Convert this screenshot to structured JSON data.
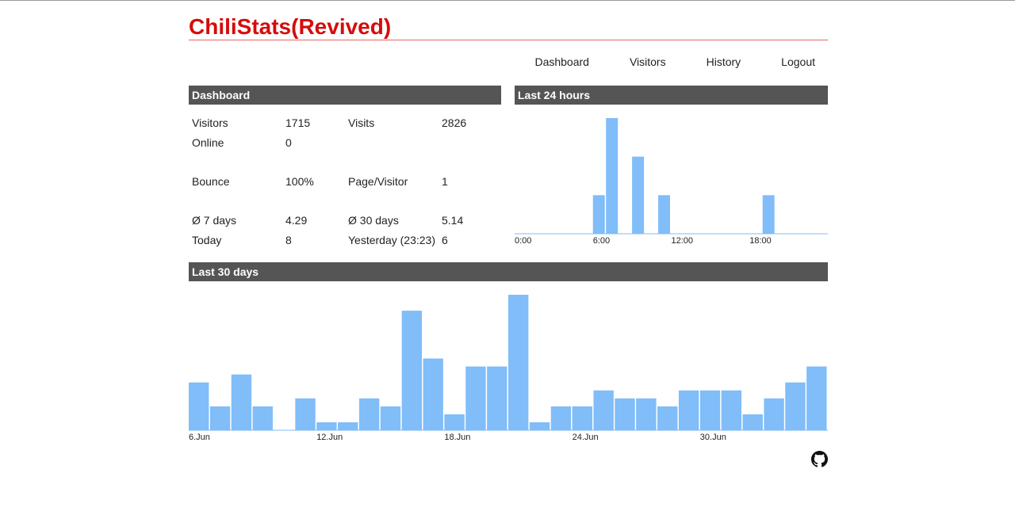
{
  "site": {
    "title": "ChiliStats(Revived)"
  },
  "nav": {
    "items": [
      "Dashboard",
      "Visitors",
      "History",
      "Logout"
    ]
  },
  "dashboard": {
    "header": "Dashboard",
    "stats": [
      {
        "label": "Visitors",
        "value": "1715"
      },
      {
        "label": "Visits",
        "value": "2826"
      },
      {
        "label": "Online",
        "value": "0"
      },
      {
        "label": "Bounce",
        "value": "100%"
      },
      {
        "label": "Page/Visitor",
        "value": "1"
      },
      {
        "label": "Ø 7 days",
        "value": "4.29"
      },
      {
        "label": "Ø 30 days",
        "value": "5.14"
      },
      {
        "label": "Today",
        "value": "8"
      },
      {
        "label": "Yesterday (23:23)",
        "value": "6"
      }
    ]
  },
  "last24": {
    "header": "Last 24 hours"
  },
  "last30": {
    "header": "Last 30 days"
  },
  "colors": {
    "bar": "#80bdf9",
    "header_bg": "#555555",
    "title": "#d60c0c"
  },
  "footer": {
    "icon": "github-icon"
  },
  "chart_data": [
    {
      "type": "bar",
      "categories": [
        "0",
        "1",
        "2",
        "3",
        "4",
        "5",
        "6",
        "7",
        "8",
        "9",
        "10",
        "11",
        "12",
        "13",
        "14",
        "15",
        "16",
        "17",
        "18",
        "19",
        "20",
        "21",
        "22",
        "23"
      ],
      "tick_labels": [
        {
          "index": 0,
          "label": "0:00"
        },
        {
          "index": 6,
          "label": "6:00"
        },
        {
          "index": 12,
          "label": "12:00"
        },
        {
          "index": 18,
          "label": "18:00"
        }
      ],
      "values": [
        0,
        0,
        0,
        0,
        0,
        0,
        1,
        3,
        0,
        2,
        0,
        1,
        0,
        0,
        0,
        0,
        0,
        0,
        0,
        1,
        0,
        0,
        0,
        0
      ],
      "ylim": [
        0,
        3
      ]
    },
    {
      "type": "bar",
      "categories": [
        "6.Jun",
        "7.Jun",
        "8.Jun",
        "9.Jun",
        "10.Jun",
        "11.Jun",
        "12.Jun",
        "13.Jun",
        "14.Jun",
        "15.Jun",
        "16.Jun",
        "17.Jun",
        "18.Jun",
        "19.Jun",
        "20.Jun",
        "21.Jun",
        "22.Jun",
        "23.Jun",
        "24.Jun",
        "25.Jun",
        "26.Jun",
        "27.Jun",
        "28.Jun",
        "29.Jun",
        "30.Jun",
        "1.Jul",
        "2.Jul",
        "3.Jul",
        "4.Jul",
        "5.Jul"
      ],
      "tick_labels": [
        {
          "index": 0,
          "label": "6.Jun"
        },
        {
          "index": 6,
          "label": "12.Jun"
        },
        {
          "index": 12,
          "label": "18.Jun"
        },
        {
          "index": 18,
          "label": "24.Jun"
        },
        {
          "index": 24,
          "label": "30.Jun"
        }
      ],
      "values": [
        6,
        3,
        7,
        3,
        0,
        4,
        1,
        1,
        4,
        3,
        15,
        9,
        2,
        8,
        8,
        17,
        1,
        3,
        3,
        5,
        4,
        4,
        3,
        5,
        5,
        5,
        2,
        4,
        6,
        8
      ],
      "ylim": [
        0,
        17
      ]
    }
  ]
}
